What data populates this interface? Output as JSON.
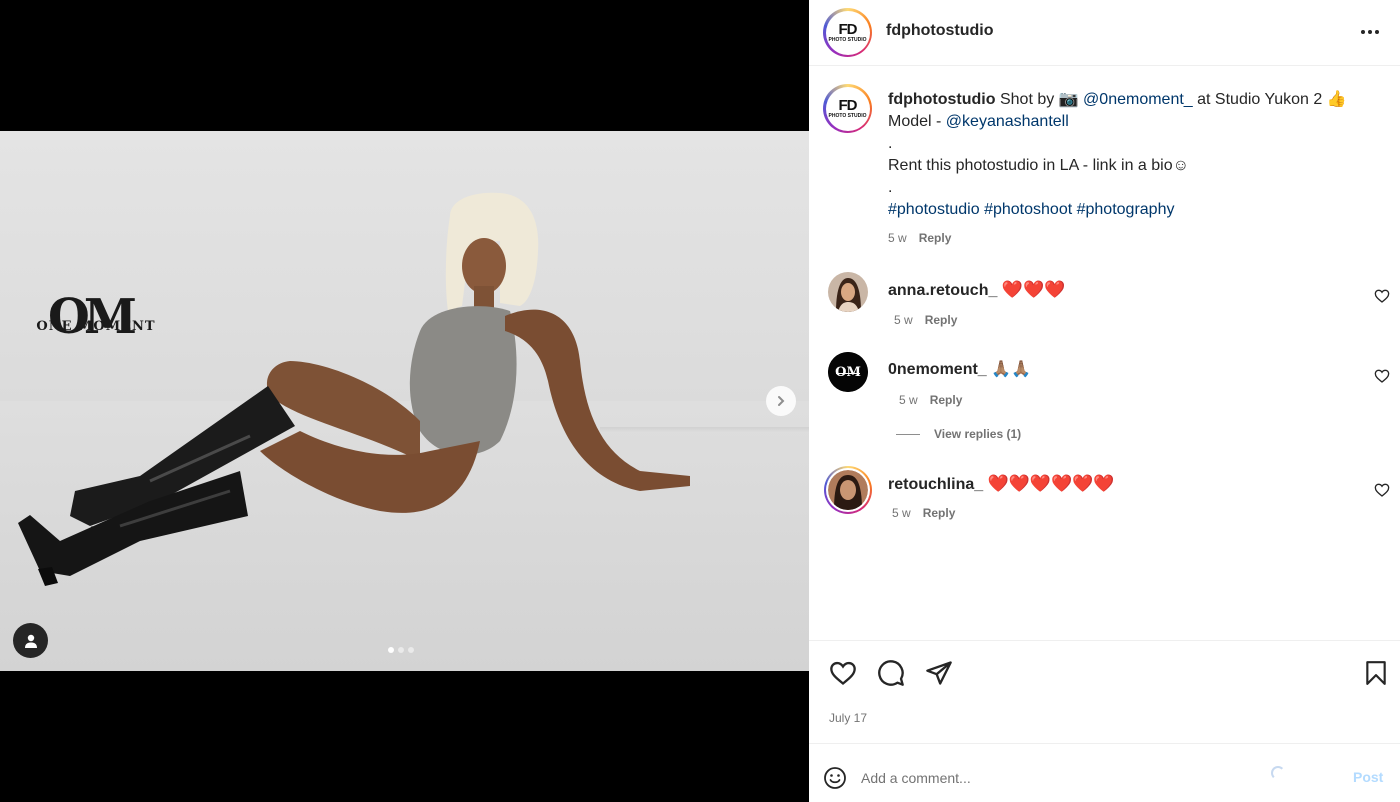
{
  "post": {
    "username": "fdphotostudio",
    "avatar_text": "FD",
    "avatar_subtext": "PHOTO STUDIO"
  },
  "media": {
    "watermark_monogram": "OM",
    "watermark_text": "ONE MOMENT",
    "carousel_count": 3,
    "carousel_active": 1
  },
  "caption": {
    "username": "fdphotostudio",
    "text_1": "Shot by 📷 ",
    "mention_1": "@0nemoment_",
    "text_2": " at Studio Yukon 2 👍",
    "line_2_prefix": "Model - ",
    "mention_2": "@keyanashantell",
    "dot_1": ".",
    "line_3": "Rent this photostudio in LA - link in a bio☺",
    "dot_2": ".",
    "hashtags": "#photostudio #photoshoot #photography",
    "time": "5 w",
    "reply": "Reply"
  },
  "comments": [
    {
      "username": "anna.retouch_",
      "text": "❤️❤️❤️",
      "time": "5 w",
      "reply": "Reply"
    },
    {
      "username": "0nemoment_",
      "text": "🙏🏽🙏🏽",
      "time": "5 w",
      "reply": "Reply",
      "view_replies": "View replies (1)"
    },
    {
      "username": "retouchlina_",
      "text": "❤️❤️❤️❤️❤️❤️",
      "time": "5 w",
      "reply": "Reply"
    }
  ],
  "footer": {
    "date": "July 17",
    "comment_placeholder": "Add a comment...",
    "post_label": "Post"
  },
  "colors": {
    "link": "#00376b",
    "muted": "#737373",
    "post_disabled": "#b3dbff"
  }
}
